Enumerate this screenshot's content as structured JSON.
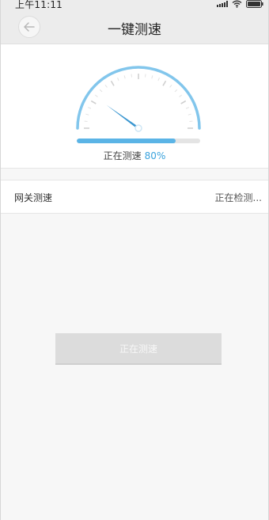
{
  "status_bar": {
    "time": "上午11:11"
  },
  "nav": {
    "title": "一键测速"
  },
  "speed_test": {
    "progress_label": "正在测速",
    "progress_percent_text": "80%",
    "progress_fraction": 0.8,
    "gauge_needle_fraction": 0.2,
    "accent_color": "#5bb4e6"
  },
  "gateway_row": {
    "label": "网关测速",
    "status": "正在检测..."
  },
  "action_button": {
    "label": "正在测速"
  }
}
